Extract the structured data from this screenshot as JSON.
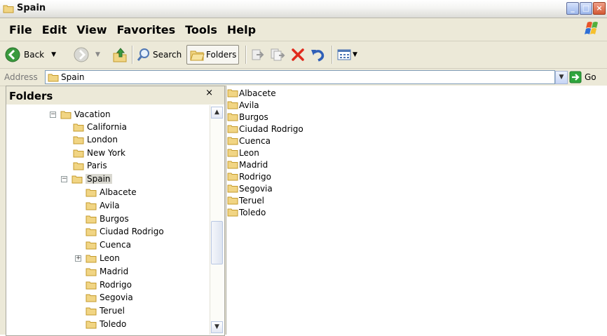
{
  "window": {
    "title": "Spain"
  },
  "menubar": {
    "items": [
      "File",
      "Edit",
      "View",
      "Favorites",
      "Tools",
      "Help"
    ]
  },
  "toolbar": {
    "back": "Back",
    "search": "Search",
    "folders": "Folders"
  },
  "address": {
    "label": "Address",
    "value": "Spain",
    "go": "Go"
  },
  "folders_pane": {
    "title": "Folders",
    "close": "×",
    "nodes": [
      "Vacation",
      "California",
      "London",
      "New York",
      "Paris",
      "Spain",
      "Albacete",
      "Avila",
      "Burgos",
      "Ciudad Rodrigo",
      "Cuenca",
      "Leon",
      "Madrid",
      "Rodrigo",
      "Segovia",
      "Teruel",
      "Toledo"
    ]
  },
  "contents": {
    "items": [
      "Albacete",
      "Avila",
      "Burgos",
      "Ciudad Rodrigo",
      "Cuenca",
      "Leon",
      "Madrid",
      "Rodrigo",
      "Segovia",
      "Teruel",
      "Toledo"
    ]
  },
  "colors": {
    "folder": "#f1d584",
    "folder_edge": "#c49a2b",
    "go_green": "#2fa53c"
  }
}
